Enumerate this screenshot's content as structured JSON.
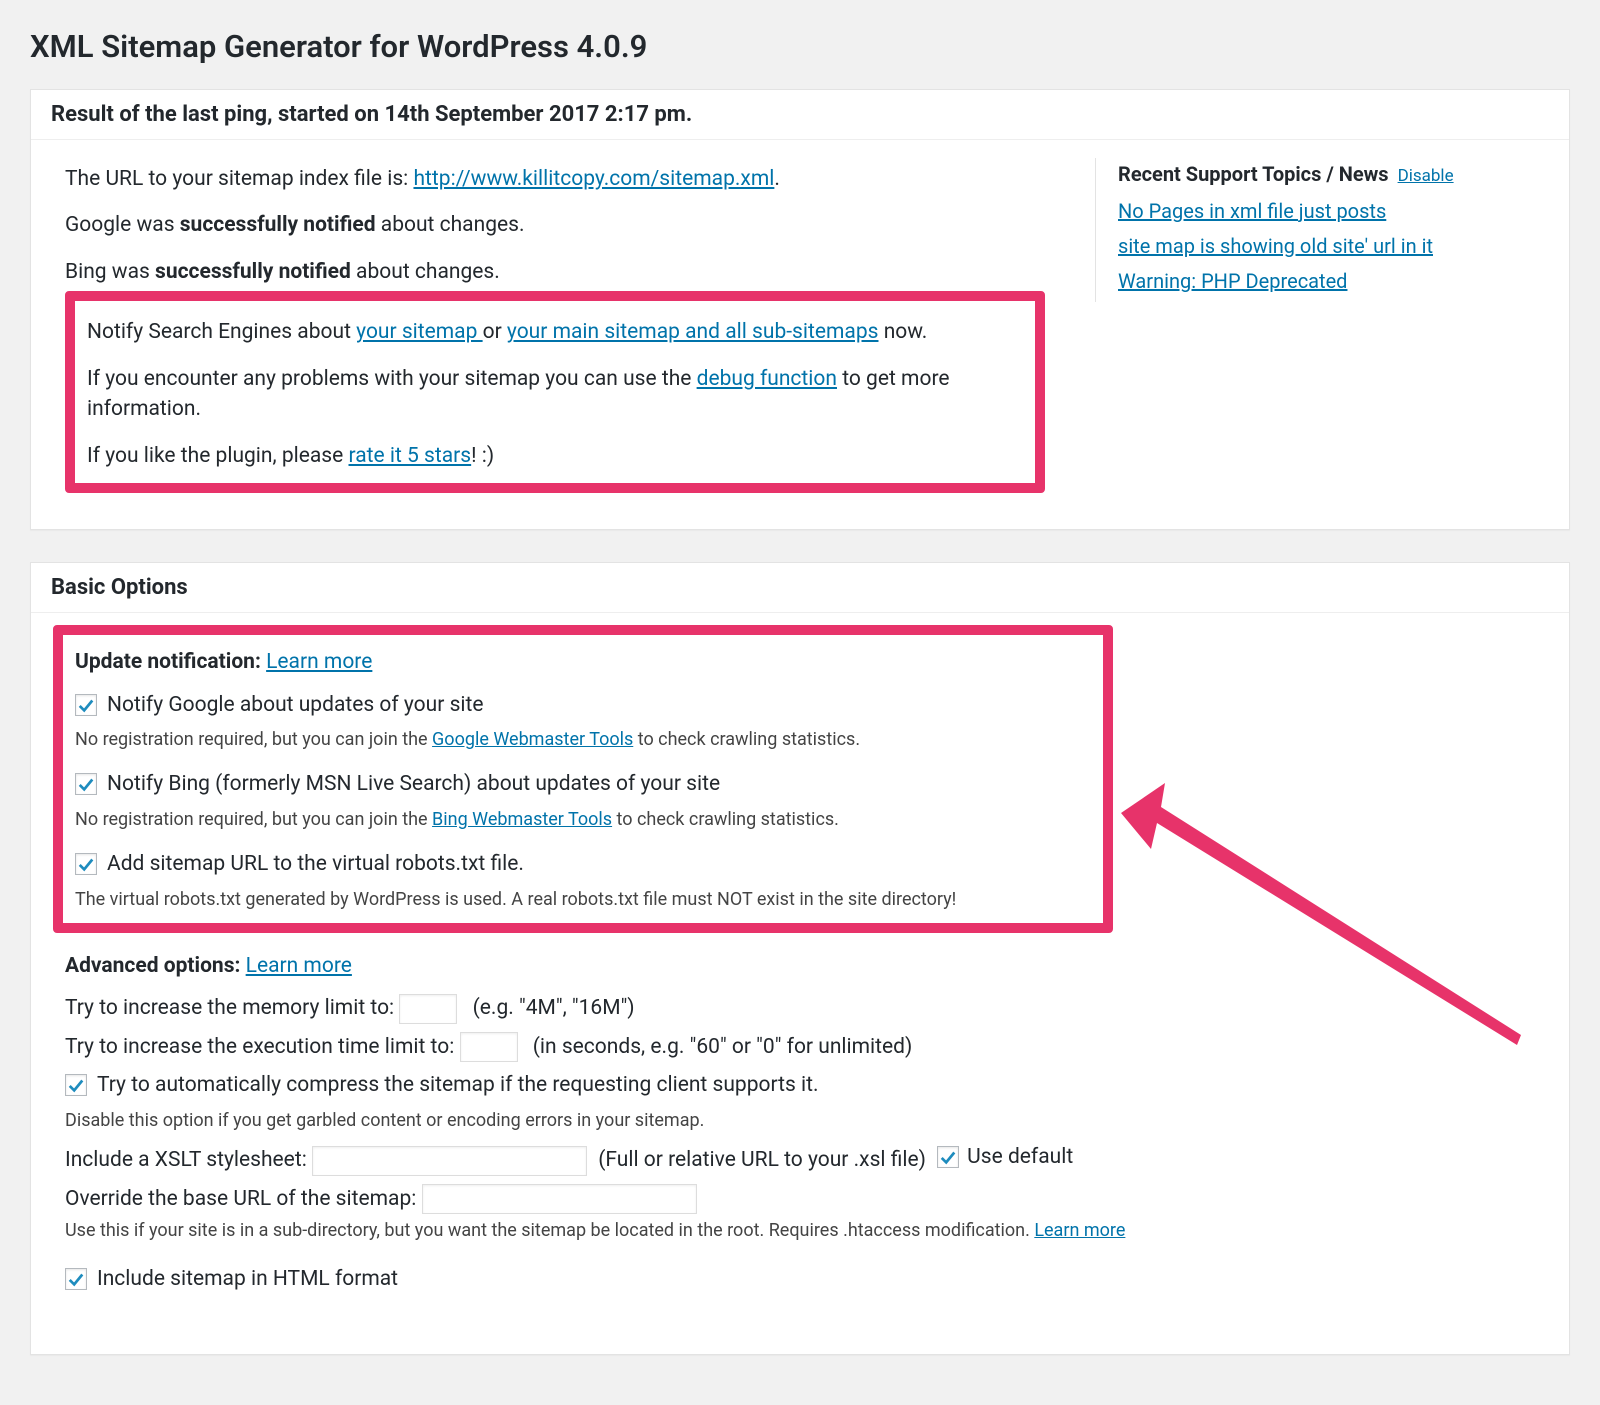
{
  "page_title": "XML Sitemap Generator for WordPress 4.0.9",
  "result_panel": {
    "heading": "Result of the last ping, started on 14th September 2017 2:17 pm.",
    "url_label_prefix": "The URL to your sitemap index file is: ",
    "url_link": "http://www.killitcopy.com/sitemap.xml",
    "google_prefix": "Google was ",
    "google_strong": "successfully notified",
    "google_suffix": " about changes.",
    "bing_prefix": "Bing was ",
    "bing_strong": "successfully notified",
    "bing_suffix": " about changes.",
    "notify_prefix": "Notify Search Engines about ",
    "notify_link1": "your sitemap ",
    "notify_mid": "or ",
    "notify_link2": "your main sitemap and all sub-sitemaps",
    "notify_suffix": " now.",
    "debug_prefix": "If you encounter any problems with your sitemap you can use the ",
    "debug_link": "debug function",
    "debug_suffix": " to get more information.",
    "rate_prefix": "If you like the plugin, please ",
    "rate_link": "rate it 5 stars",
    "rate_suffix": "! :)"
  },
  "sidebar": {
    "title": "Recent Support Topics / News",
    "disable": "Disable",
    "items": [
      "No Pages in xml file just posts",
      "site map is showing old site' url in it",
      "Warning: PHP Deprecated"
    ]
  },
  "basic": {
    "heading": "Basic Options",
    "update_title": "Update notification:",
    "learn_more": "Learn more",
    "opt_google_label": "Notify Google about updates of your site",
    "opt_google_desc_prefix": "No registration required, but you can join the ",
    "opt_google_desc_link": "Google Webmaster Tools",
    "opt_google_desc_suffix": " to check crawling statistics.",
    "opt_bing_label": "Notify Bing (formerly MSN Live Search) about updates of your site",
    "opt_bing_desc_prefix": "No registration required, but you can join the ",
    "opt_bing_desc_link": "Bing Webmaster Tools",
    "opt_bing_desc_suffix": " to check crawling statistics.",
    "opt_robots_label": "Add sitemap URL to the virtual robots.txt file.",
    "opt_robots_desc": "The virtual robots.txt generated by WordPress is used. A real robots.txt file must NOT exist in the site directory!",
    "adv_title": "Advanced options:",
    "mem_label": "Try to increase the memory limit to:",
    "mem_hint": "(e.g. \"4M\", \"16M\")",
    "exec_label": "Try to increase the execution time limit to:",
    "exec_hint": "(in seconds, e.g. \"60\" or \"0\" for unlimited)",
    "compress_label": "Try to automatically compress the sitemap if the requesting client supports it.",
    "compress_desc": "Disable this option if you get garbled content or encoding errors in your sitemap.",
    "xslt_label": "Include a XSLT stylesheet:",
    "xslt_hint": "(Full or relative URL to your .xsl file)",
    "xslt_default": "Use default",
    "base_label": "Override the base URL of the sitemap:",
    "base_desc_prefix": "Use this if your site is in a sub-directory, but you want the sitemap be located in the root. Requires .htaccess modification. ",
    "html_label": "Include sitemap in HTML format"
  }
}
